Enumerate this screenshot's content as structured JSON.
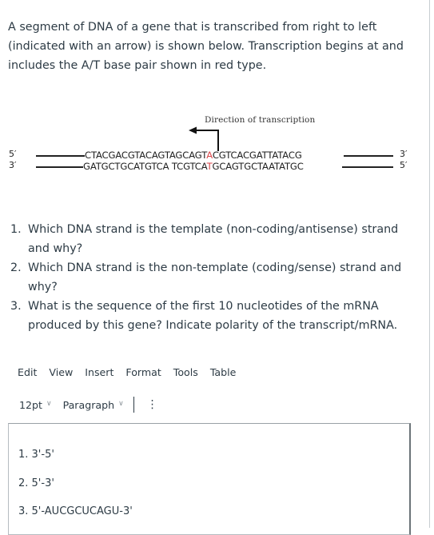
{
  "intro_text": "A segment of DNA of a gene that is transcribed from right to left (indicated with an arrow) is shown below. Transcription begins at and includes the A/T base pair shown in red type.",
  "figure": {
    "caption": "Direction of transcription",
    "arrow_icon": "left-arrow-icon",
    "top_strand": {
      "left_end": "5′",
      "right_end": "3′",
      "before_red": "CTACGACGTACAGTAGCAGT",
      "red": "A",
      "after_red": "CGTCACGATTATACG"
    },
    "bottom_strand": {
      "left_end": "3′",
      "right_end": "5′",
      "before_red": "GATGCTGCATGTCA TCGTCA",
      "red": "T",
      "after_red": "GCAGTGCTAATATGC"
    },
    "highlight_color": "#d9464a"
  },
  "questions": [
    {
      "num": "1.",
      "text": "Which DNA strand is the template (non-coding/antisense) strand and why?"
    },
    {
      "num": "2.",
      "text": "Which DNA strand is the non-template (coding/sense) strand and why?"
    },
    {
      "num": "3.",
      "text": "What is the sequence of the first 10 nucleotides of the mRNA produced by this gene? Indicate polarity of the transcript/mRNA."
    }
  ],
  "editor": {
    "menu": [
      "Edit",
      "View",
      "Insert",
      "Format",
      "Tools",
      "Table"
    ],
    "toolbar": {
      "font_size": "12pt",
      "block_format": "Paragraph",
      "more_icon": "vertical-dots-icon"
    },
    "content": [
      "1. 3'-5'",
      "2. 5'-3'",
      "3. 5'-AUCGCUCAGU-3'"
    ]
  }
}
